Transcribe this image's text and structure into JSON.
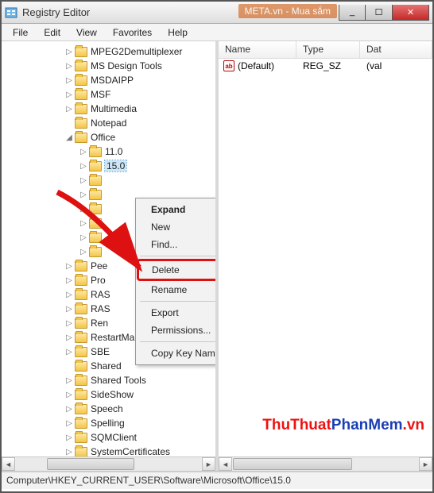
{
  "window": {
    "title": "Registry Editor",
    "behind_text": "META.vn - Mua sắm"
  },
  "win_btns": {
    "min": "_",
    "max": "☐",
    "close": "✕"
  },
  "menu": {
    "file": "File",
    "edit": "Edit",
    "view": "View",
    "favorites": "Favorites",
    "help": "Help"
  },
  "tree": {
    "items": [
      {
        "label": "MPEG2Demultiplexer",
        "indent": "ind0",
        "twisty": "▷"
      },
      {
        "label": "MS Design Tools",
        "indent": "ind0",
        "twisty": "▷"
      },
      {
        "label": "MSDAIPP",
        "indent": "ind0",
        "twisty": "▷"
      },
      {
        "label": "MSF",
        "indent": "ind0",
        "twisty": "▷"
      },
      {
        "label": "Multimedia",
        "indent": "ind0",
        "twisty": "▷"
      },
      {
        "label": "Notepad",
        "indent": "ind0",
        "twisty": ""
      },
      {
        "label": "Office",
        "indent": "ind0",
        "twisty": "◢"
      },
      {
        "label": "11.0",
        "indent": "ind1",
        "twisty": "▷"
      },
      {
        "label": "15.0",
        "indent": "ind1",
        "twisty": "▷",
        "selected": true
      },
      {
        "label": "",
        "indent": "indx",
        "twisty": "▷"
      },
      {
        "label": "",
        "indent": "indx",
        "twisty": "▷"
      },
      {
        "label": "",
        "indent": "indx",
        "twisty": "▷"
      },
      {
        "label": "",
        "indent": "indx",
        "twisty": "▷"
      },
      {
        "label": "",
        "indent": "indx",
        "twisty": "▷"
      },
      {
        "label": "",
        "indent": "indx",
        "twisty": "▷"
      },
      {
        "label": "Pee",
        "indent": "ind0",
        "twisty": "▷"
      },
      {
        "label": "Pro",
        "indent": "ind0",
        "twisty": "▷"
      },
      {
        "label": "RAS",
        "indent": "ind0",
        "twisty": "▷"
      },
      {
        "label": "RAS",
        "indent": "ind0",
        "twisty": "▷"
      },
      {
        "label": "Ren",
        "indent": "ind0",
        "twisty": "▷"
      },
      {
        "label": "RestartManager",
        "indent": "ind0",
        "twisty": "▷"
      },
      {
        "label": "SBE",
        "indent": "ind0",
        "twisty": "▷"
      },
      {
        "label": "Shared",
        "indent": "ind0",
        "twisty": ""
      },
      {
        "label": "Shared Tools",
        "indent": "ind0",
        "twisty": "▷"
      },
      {
        "label": "SideShow",
        "indent": "ind0",
        "twisty": "▷"
      },
      {
        "label": "Speech",
        "indent": "ind0",
        "twisty": "▷"
      },
      {
        "label": "Spelling",
        "indent": "ind0",
        "twisty": "▷"
      },
      {
        "label": "SQMClient",
        "indent": "ind0",
        "twisty": "▷"
      },
      {
        "label": "SystemCertificates",
        "indent": "ind0",
        "twisty": "▷"
      }
    ]
  },
  "context_menu": {
    "expand": "Expand",
    "new": "New",
    "find": "Find...",
    "delete": "Delete",
    "rename": "Rename",
    "export": "Export",
    "permissions": "Permissions...",
    "copy_key": "Copy Key Name"
  },
  "list": {
    "headers": {
      "name": "Name",
      "type": "Type",
      "data": "Dat"
    },
    "row": {
      "name": "(Default)",
      "type": "REG_SZ",
      "data": "(val",
      "icon": "ab"
    }
  },
  "watermark": {
    "part1": "ThuThuat",
    "part2": "PhanMem",
    "part3": ".vn"
  },
  "statusbar": {
    "path": "Computer\\HKEY_CURRENT_USER\\Software\\Microsoft\\Office\\15.0"
  },
  "colors": {
    "highlight_border": "#d11",
    "arrow": "#d11"
  }
}
